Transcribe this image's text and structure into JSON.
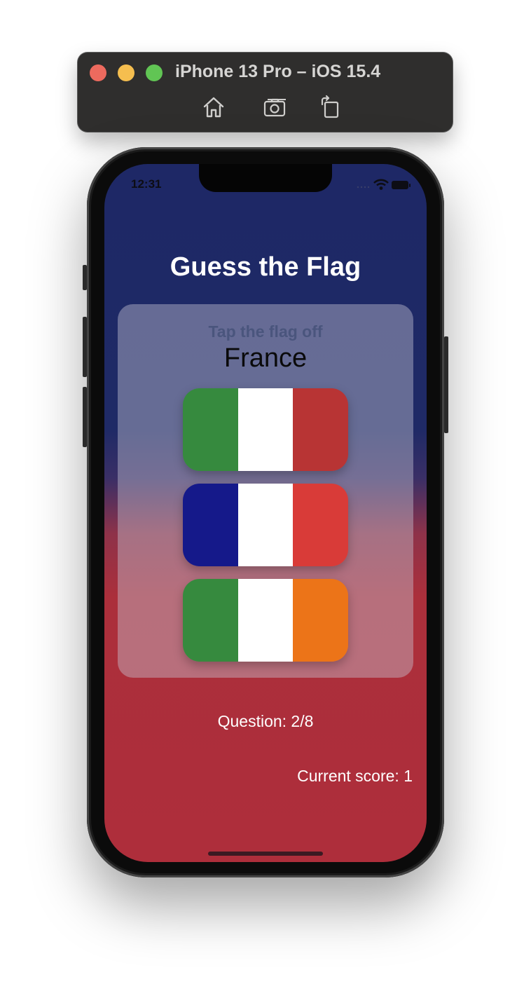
{
  "simulator": {
    "title": "iPhone 13 Pro – iOS 15.4",
    "buttons": [
      "home-icon",
      "screenshot-icon",
      "rotate-icon"
    ]
  },
  "status_bar": {
    "time": "12:31",
    "icons": [
      "signal-icon",
      "wifi-icon",
      "battery-icon"
    ]
  },
  "app": {
    "title": "Guess the Flag",
    "prompt_subtitle": "Tap the flag off",
    "prompt_country": "France",
    "flags": [
      {
        "name": "italy",
        "colors": [
          "#368a3e",
          "#ffffff",
          "#b83434"
        ]
      },
      {
        "name": "france",
        "colors": [
          "#15198a",
          "#ffffff",
          "#d93b38"
        ]
      },
      {
        "name": "ireland",
        "colors": [
          "#368a3e",
          "#ffffff",
          "#ec7418"
        ]
      }
    ],
    "question_label": "Question: 2/8",
    "score_label": "Current score: 1"
  },
  "colors": {
    "gradient_top": "#1e2866",
    "gradient_bottom": "#ae2e3b"
  }
}
